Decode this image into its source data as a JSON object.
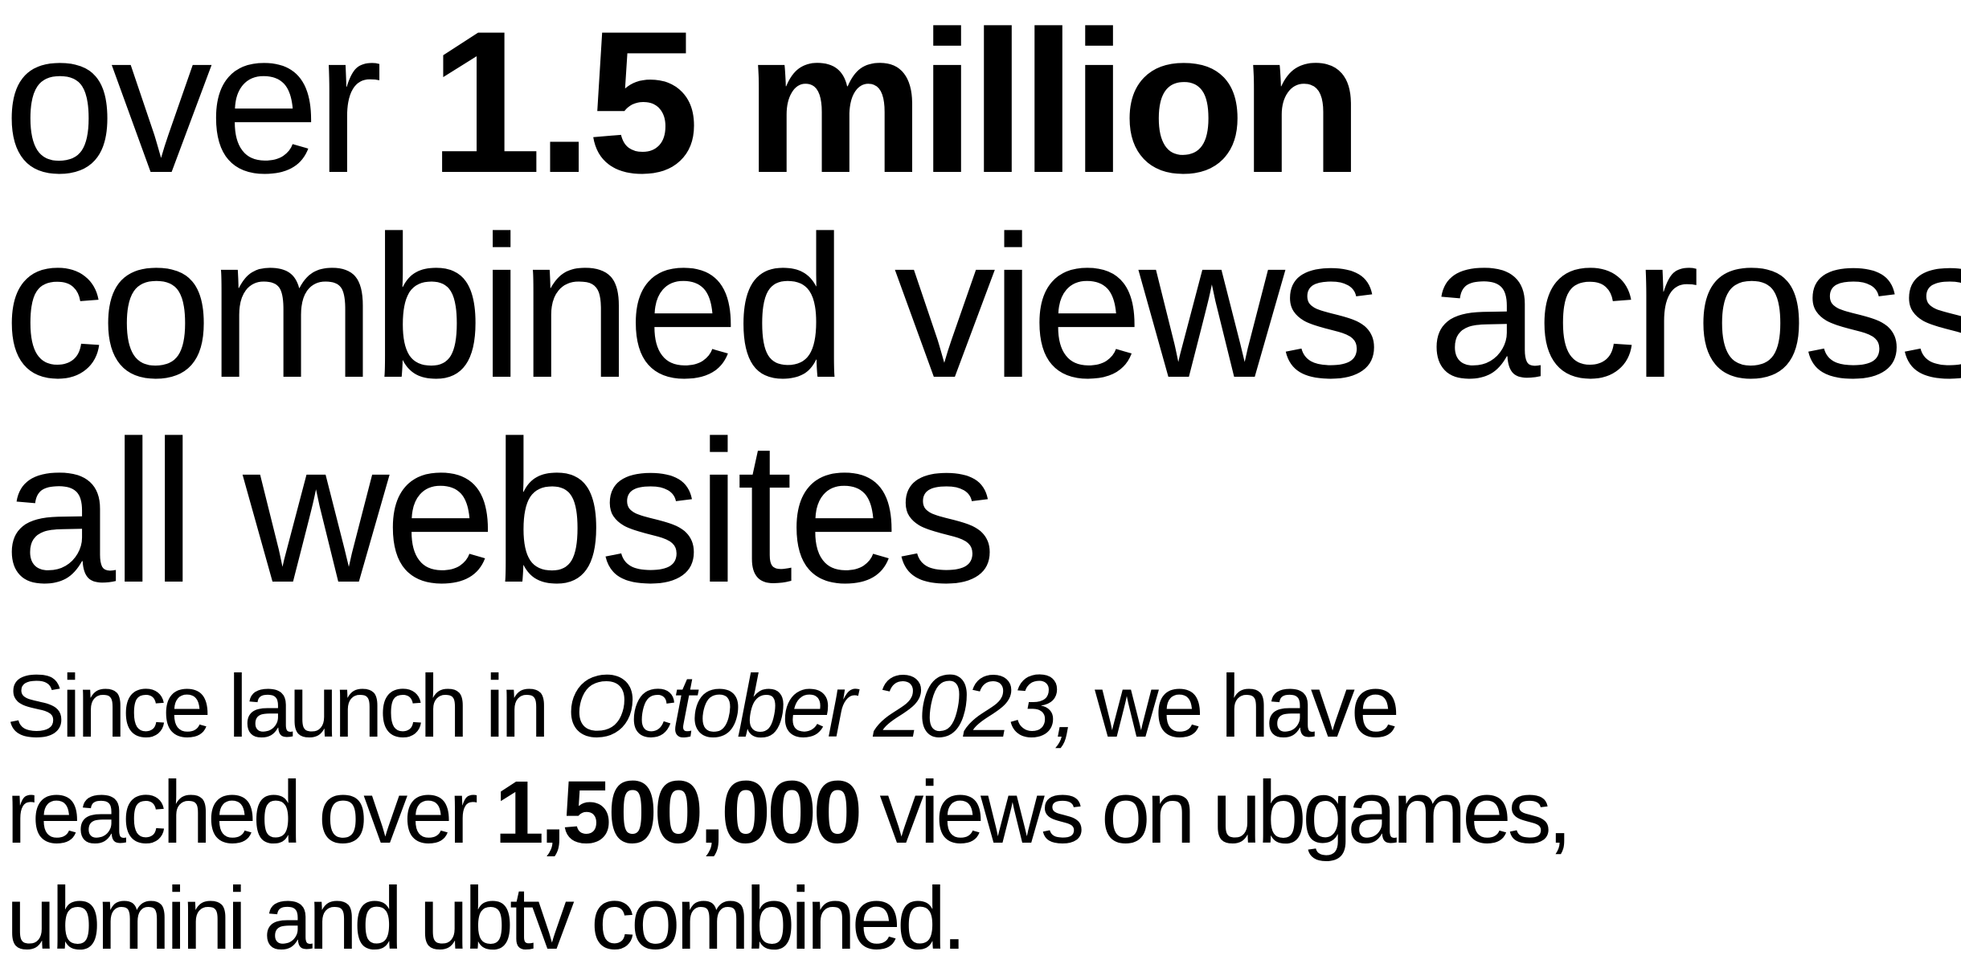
{
  "headline": {
    "prefix": "over ",
    "highlight": "1.5 million",
    "line2": "combined views across",
    "line3": "all websites"
  },
  "body": {
    "line1_start": "Since launch in ",
    "line1_date": "October 2023,",
    "line1_end": " we have",
    "line2_start": "reached over ",
    "line2_number": "1,500,000",
    "line2_end": " views on ubgames,",
    "line3": "ubmini and ubtv combined."
  },
  "colors": {
    "text": "#000000",
    "background": "#ffffff"
  }
}
